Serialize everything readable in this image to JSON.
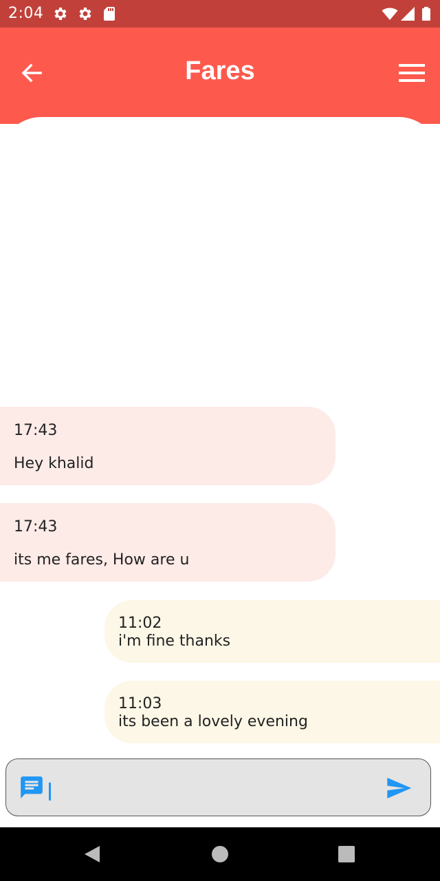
{
  "status_bar": {
    "time": "2:04",
    "left_icons": [
      "settings-icon",
      "settings-icon",
      "sd-card-icon"
    ],
    "right_icons": [
      "wifi-icon",
      "cell-signal-icon",
      "battery-icon"
    ]
  },
  "header": {
    "title": "Fares",
    "back_icon": "arrow-back-icon",
    "menu_icon": "hamburger-menu-icon",
    "color": "#fe594d",
    "status_color": "#c1413a"
  },
  "messages": [
    {
      "direction": "incoming",
      "time": "17:43",
      "text": "Hey khalid"
    },
    {
      "direction": "incoming",
      "time": "17:43",
      "text": "its me fares, How are u"
    },
    {
      "direction": "outgoing",
      "time": "11:02",
      "text": "i'm fine thanks"
    },
    {
      "direction": "outgoing",
      "time": "11:03",
      "text": "its been a lovely evening"
    }
  ],
  "composer": {
    "value": "",
    "placeholder": "",
    "left_icon": "message-icon",
    "send_icon": "send-icon",
    "accent": "#2196f3"
  },
  "colors": {
    "incoming_bubble": "#fdebe8",
    "outgoing_bubble": "#fdf7e7"
  },
  "nav_bar": {
    "icons": [
      "nav-back-icon",
      "nav-home-icon",
      "nav-recents-icon"
    ]
  }
}
